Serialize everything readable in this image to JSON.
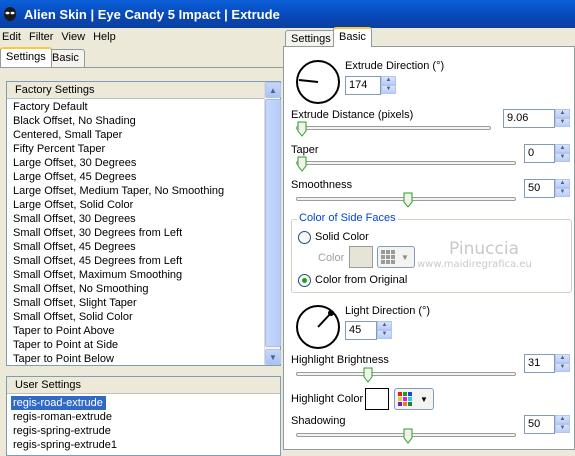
{
  "window": {
    "title": "Alien Skin  |  Eye Candy 5 Impact  |  Extrude"
  },
  "menu": [
    "Edit",
    "Filter",
    "View",
    "Help"
  ],
  "left_tabs": [
    "Settings",
    "Basic"
  ],
  "right_tabs": [
    "Settings",
    "Basic"
  ],
  "factory": {
    "title": "Factory Settings",
    "items": [
      "Factory Default",
      "Black Offset, No Shading",
      "Centered, Small Taper",
      "Fifty Percent Taper",
      "Large Offset, 30 Degrees",
      "Large Offset, 45 Degrees",
      "Large Offset, Medium Taper, No Smoothing",
      "Large Offset, Solid Color",
      "Small Offset, 30 Degrees",
      "Small Offset, 30 Degrees from Left",
      "Small Offset, 45 Degrees",
      "Small Offset, 45 Degrees from Left",
      "Small Offset, Maximum Smoothing",
      "Small Offset, No Smoothing",
      "Small Offset, Slight Taper",
      "Small Offset, Solid Color",
      "Taper to Point Above",
      "Taper to Point at Side",
      "Taper to Point Below"
    ]
  },
  "user": {
    "title": "User Settings",
    "items": [
      "regis-road-extrude",
      "regis-roman-extrude",
      "regis-spring-extrude",
      "regis-spring-extrude1"
    ],
    "selected_index": 0
  },
  "basic": {
    "extrude_direction": {
      "label": "Extrude Direction (°)",
      "value": "174"
    },
    "extrude_distance": {
      "label": "Extrude Distance (pixels)",
      "value": "9.06"
    },
    "taper": {
      "label": "Taper",
      "value": "0"
    },
    "smoothness": {
      "label": "Smoothness",
      "value": "50"
    },
    "side_faces": {
      "title": "Color of Side Faces",
      "solid_color_label": "Solid Color",
      "color_label": "Color",
      "color_from_original_label": "Color from Original",
      "selected": "Color from Original"
    },
    "light_direction": {
      "label": "Light Direction (°)",
      "value": "45"
    },
    "highlight_brightness": {
      "label": "Highlight Brightness",
      "value": "31"
    },
    "highlight_color": {
      "label": "Highlight Color",
      "value": "#ffffff"
    },
    "shadowing": {
      "label": "Shadowing",
      "value": "50"
    }
  },
  "watermark": {
    "line1": "Pinuccia",
    "line2": "www.maidiregrafica.eu"
  },
  "colors": {
    "title_bar": "#0847b8",
    "selection": "#316ac5",
    "tab_highlight": "#ffc83c",
    "radio_dot": "#21a121"
  }
}
